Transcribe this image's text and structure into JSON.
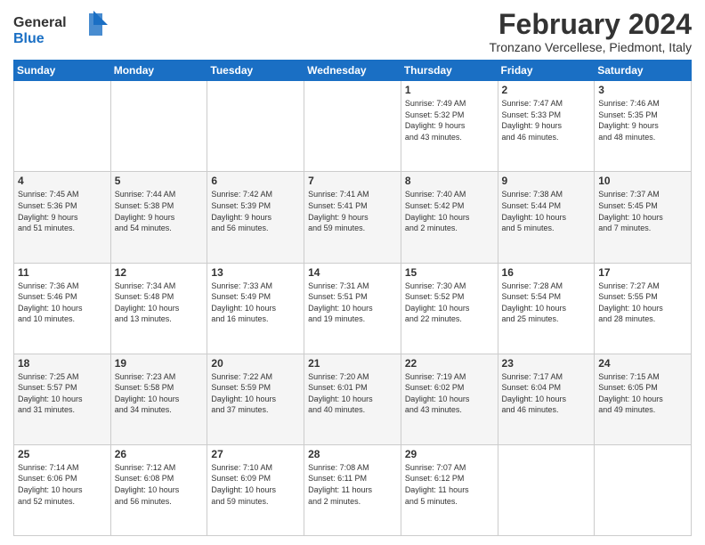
{
  "logo": {
    "general": "General",
    "blue": "Blue"
  },
  "header": {
    "month": "February 2024",
    "location": "Tronzano Vercellese, Piedmont, Italy"
  },
  "days_of_week": [
    "Sunday",
    "Monday",
    "Tuesday",
    "Wednesday",
    "Thursday",
    "Friday",
    "Saturday"
  ],
  "weeks": [
    [
      {
        "day": "",
        "info": ""
      },
      {
        "day": "",
        "info": ""
      },
      {
        "day": "",
        "info": ""
      },
      {
        "day": "",
        "info": ""
      },
      {
        "day": "1",
        "info": "Sunrise: 7:49 AM\nSunset: 5:32 PM\nDaylight: 9 hours\nand 43 minutes."
      },
      {
        "day": "2",
        "info": "Sunrise: 7:47 AM\nSunset: 5:33 PM\nDaylight: 9 hours\nand 46 minutes."
      },
      {
        "day": "3",
        "info": "Sunrise: 7:46 AM\nSunset: 5:35 PM\nDaylight: 9 hours\nand 48 minutes."
      }
    ],
    [
      {
        "day": "4",
        "info": "Sunrise: 7:45 AM\nSunset: 5:36 PM\nDaylight: 9 hours\nand 51 minutes."
      },
      {
        "day": "5",
        "info": "Sunrise: 7:44 AM\nSunset: 5:38 PM\nDaylight: 9 hours\nand 54 minutes."
      },
      {
        "day": "6",
        "info": "Sunrise: 7:42 AM\nSunset: 5:39 PM\nDaylight: 9 hours\nand 56 minutes."
      },
      {
        "day": "7",
        "info": "Sunrise: 7:41 AM\nSunset: 5:41 PM\nDaylight: 9 hours\nand 59 minutes."
      },
      {
        "day": "8",
        "info": "Sunrise: 7:40 AM\nSunset: 5:42 PM\nDaylight: 10 hours\nand 2 minutes."
      },
      {
        "day": "9",
        "info": "Sunrise: 7:38 AM\nSunset: 5:44 PM\nDaylight: 10 hours\nand 5 minutes."
      },
      {
        "day": "10",
        "info": "Sunrise: 7:37 AM\nSunset: 5:45 PM\nDaylight: 10 hours\nand 7 minutes."
      }
    ],
    [
      {
        "day": "11",
        "info": "Sunrise: 7:36 AM\nSunset: 5:46 PM\nDaylight: 10 hours\nand 10 minutes."
      },
      {
        "day": "12",
        "info": "Sunrise: 7:34 AM\nSunset: 5:48 PM\nDaylight: 10 hours\nand 13 minutes."
      },
      {
        "day": "13",
        "info": "Sunrise: 7:33 AM\nSunset: 5:49 PM\nDaylight: 10 hours\nand 16 minutes."
      },
      {
        "day": "14",
        "info": "Sunrise: 7:31 AM\nSunset: 5:51 PM\nDaylight: 10 hours\nand 19 minutes."
      },
      {
        "day": "15",
        "info": "Sunrise: 7:30 AM\nSunset: 5:52 PM\nDaylight: 10 hours\nand 22 minutes."
      },
      {
        "day": "16",
        "info": "Sunrise: 7:28 AM\nSunset: 5:54 PM\nDaylight: 10 hours\nand 25 minutes."
      },
      {
        "day": "17",
        "info": "Sunrise: 7:27 AM\nSunset: 5:55 PM\nDaylight: 10 hours\nand 28 minutes."
      }
    ],
    [
      {
        "day": "18",
        "info": "Sunrise: 7:25 AM\nSunset: 5:57 PM\nDaylight: 10 hours\nand 31 minutes."
      },
      {
        "day": "19",
        "info": "Sunrise: 7:23 AM\nSunset: 5:58 PM\nDaylight: 10 hours\nand 34 minutes."
      },
      {
        "day": "20",
        "info": "Sunrise: 7:22 AM\nSunset: 5:59 PM\nDaylight: 10 hours\nand 37 minutes."
      },
      {
        "day": "21",
        "info": "Sunrise: 7:20 AM\nSunset: 6:01 PM\nDaylight: 10 hours\nand 40 minutes."
      },
      {
        "day": "22",
        "info": "Sunrise: 7:19 AM\nSunset: 6:02 PM\nDaylight: 10 hours\nand 43 minutes."
      },
      {
        "day": "23",
        "info": "Sunrise: 7:17 AM\nSunset: 6:04 PM\nDaylight: 10 hours\nand 46 minutes."
      },
      {
        "day": "24",
        "info": "Sunrise: 7:15 AM\nSunset: 6:05 PM\nDaylight: 10 hours\nand 49 minutes."
      }
    ],
    [
      {
        "day": "25",
        "info": "Sunrise: 7:14 AM\nSunset: 6:06 PM\nDaylight: 10 hours\nand 52 minutes."
      },
      {
        "day": "26",
        "info": "Sunrise: 7:12 AM\nSunset: 6:08 PM\nDaylight: 10 hours\nand 56 minutes."
      },
      {
        "day": "27",
        "info": "Sunrise: 7:10 AM\nSunset: 6:09 PM\nDaylight: 10 hours\nand 59 minutes."
      },
      {
        "day": "28",
        "info": "Sunrise: 7:08 AM\nSunset: 6:11 PM\nDaylight: 11 hours\nand 2 minutes."
      },
      {
        "day": "29",
        "info": "Sunrise: 7:07 AM\nSunset: 6:12 PM\nDaylight: 11 hours\nand 5 minutes."
      },
      {
        "day": "",
        "info": ""
      },
      {
        "day": "",
        "info": ""
      }
    ]
  ]
}
